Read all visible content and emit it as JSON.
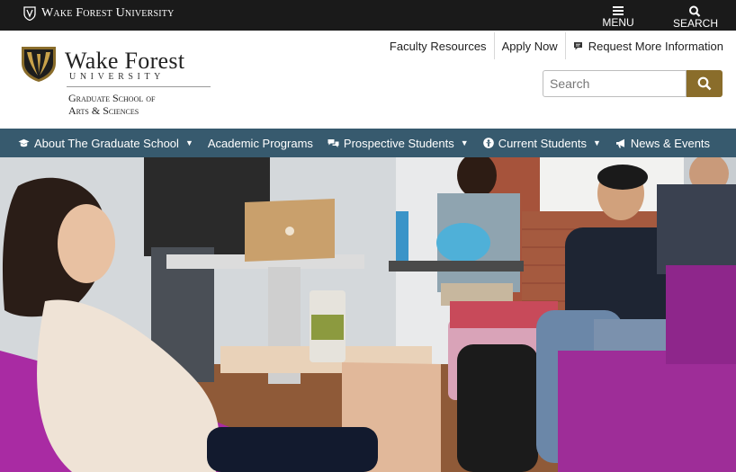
{
  "topbar": {
    "brand": "Wake Forest University",
    "menu_label": "MENU",
    "search_label": "SEARCH"
  },
  "logo": {
    "name": "Wake Forest",
    "university": "UNIVERSITY",
    "school_line1": "Graduate School of",
    "school_line2": "Arts & Sciences"
  },
  "utility_links": {
    "faculty": "Faculty Resources",
    "apply": "Apply Now",
    "request": "Request More Information"
  },
  "search": {
    "placeholder": "Search"
  },
  "nav": {
    "about": "About The Graduate School",
    "academic": "Academic Programs",
    "prospective": "Prospective Students",
    "current": "Current Students",
    "news": "News & Events"
  },
  "colors": {
    "topbar": "#1a1a1a",
    "nav": "#375a6e",
    "gold": "#8a6d2b"
  },
  "hero": {
    "description_icon": "students-photo"
  }
}
